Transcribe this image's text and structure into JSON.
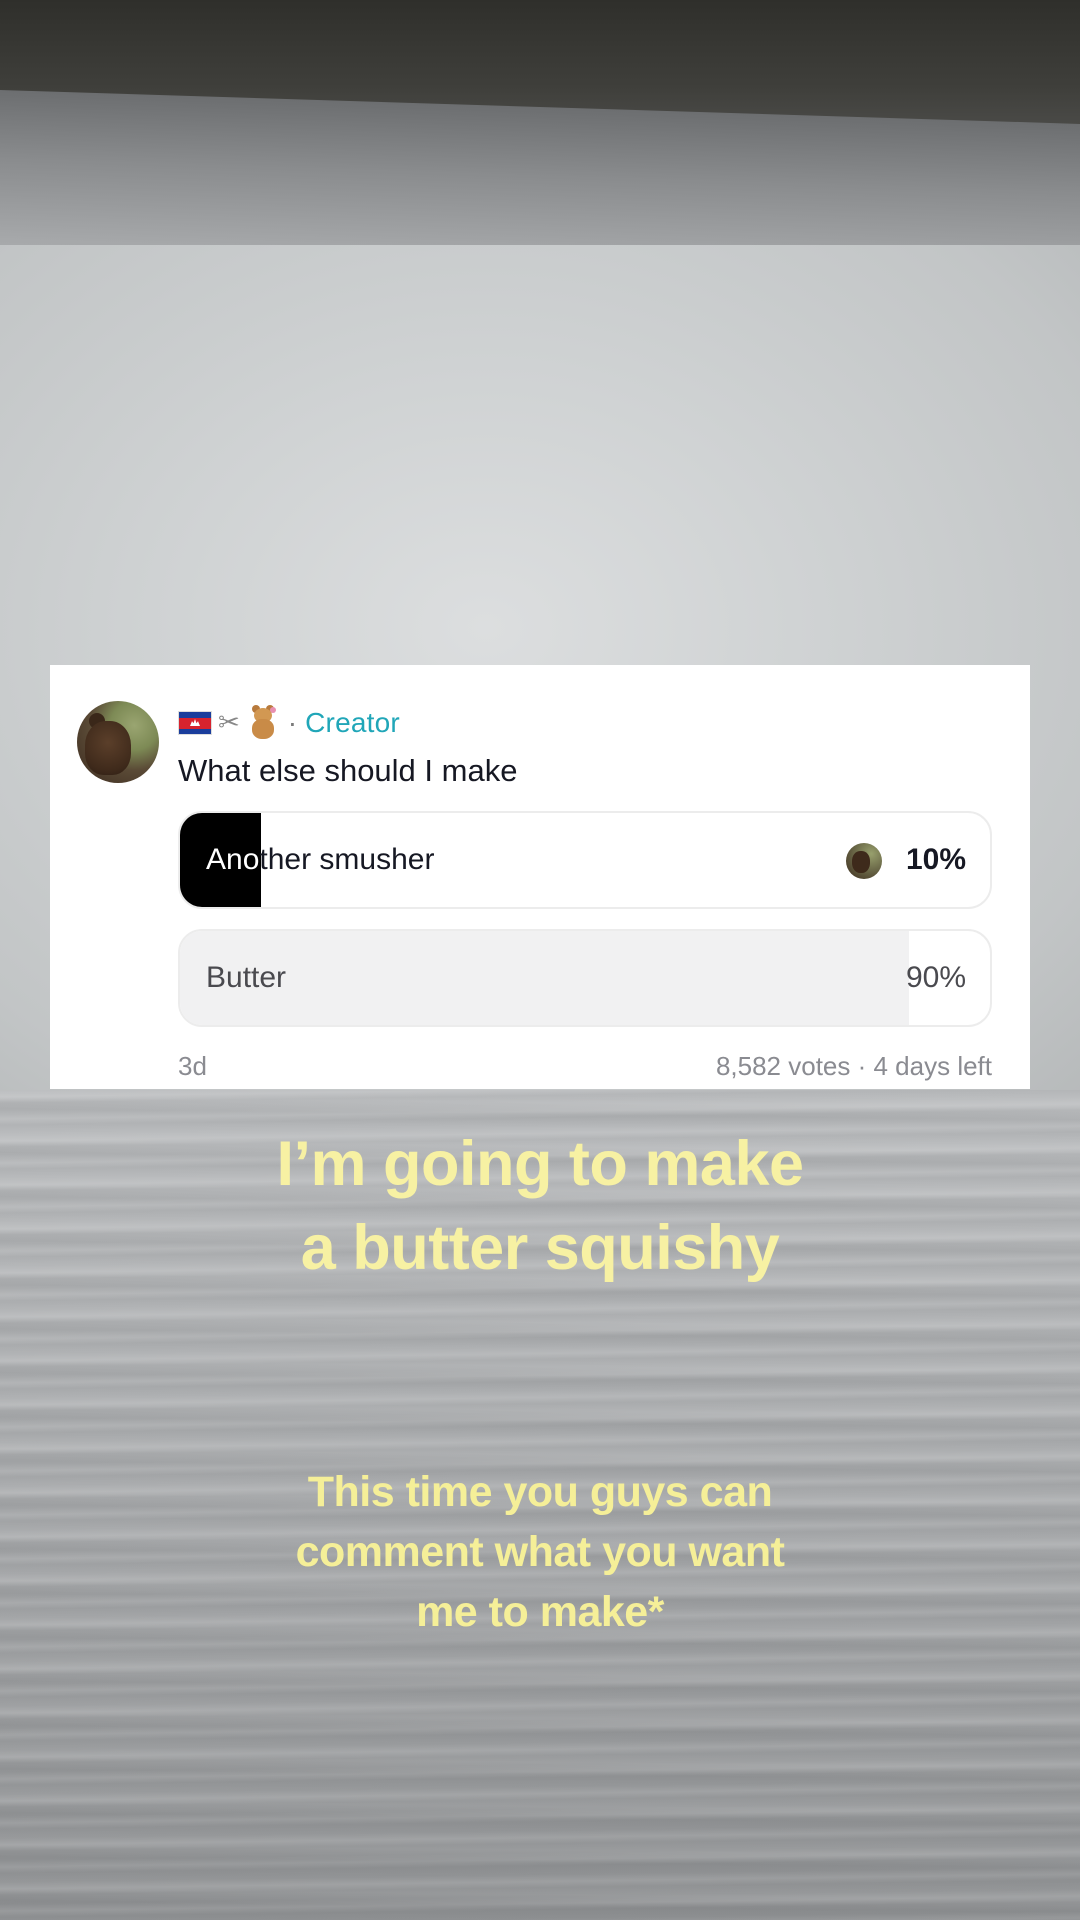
{
  "poll": {
    "creator_flag_icon": "cambodia-flag-icon",
    "creator_emojis": [
      "scissors-icon",
      "teddy-bear-icon"
    ],
    "separator": "·",
    "creator_label": "Creator",
    "question": "What else should I make",
    "options": [
      {
        "label": "Another smusher",
        "percent": "10%",
        "fill_fraction": 0.1,
        "selected": true
      },
      {
        "label": "Butter",
        "percent": "90%",
        "fill_fraction": 0.9,
        "selected": false
      }
    ],
    "age": "3d",
    "stats": "8,582 votes · 4 days left",
    "colors": {
      "creator": "#20a6b8",
      "selected_fill": "#000000",
      "other_fill": "#f1f1f2"
    }
  },
  "captions": {
    "headline": [
      "I’m going to make",
      "a butter squishy"
    ],
    "subtext": [
      "This time you guys can",
      "comment what you want",
      "me to make*"
    ],
    "color": "#f7f1a3"
  }
}
